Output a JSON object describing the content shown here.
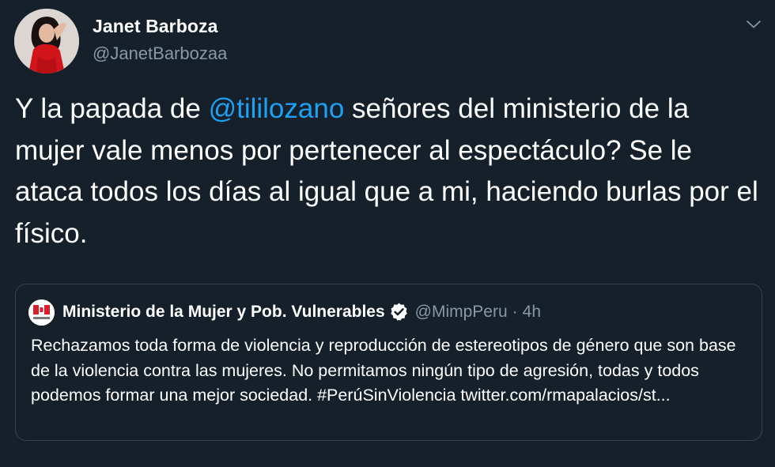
{
  "author": {
    "name": "Janet Barboza",
    "handle": "@JanetBarbozaa",
    "avatar_icon": "profile-photo-woman-red-dress"
  },
  "menu_icon": "chevron-down-icon",
  "tweet": {
    "text_before": "Y la papada de ",
    "mention": "@tililozano",
    "text_after": " señores del ministerio de la mujer vale menos por pertenecer al espectáculo? Se le ataca todos los días al igual que a mi, haciendo burlas por el físico."
  },
  "quoted": {
    "name": "Ministerio de la Mujer y Pob. Vulnerables",
    "verified_icon": "verified-badge-icon",
    "handle": "@MimpPeru",
    "separator": "·",
    "time": "4h",
    "text": "Rechazamos toda forma de violencia y reproducción de estereotipos de género que son base de la violencia contra las mujeres. No permitamos ningún tipo de agresión, todas y todos podemos formar una mejor sociedad. #PerúSinViolencia twitter.com/rmapalacios/st..."
  },
  "colors": {
    "background": "#15202b",
    "text": "#ffffff",
    "secondary_text": "#8899a6",
    "mention": "#1da1f2",
    "border": "#38444d"
  }
}
